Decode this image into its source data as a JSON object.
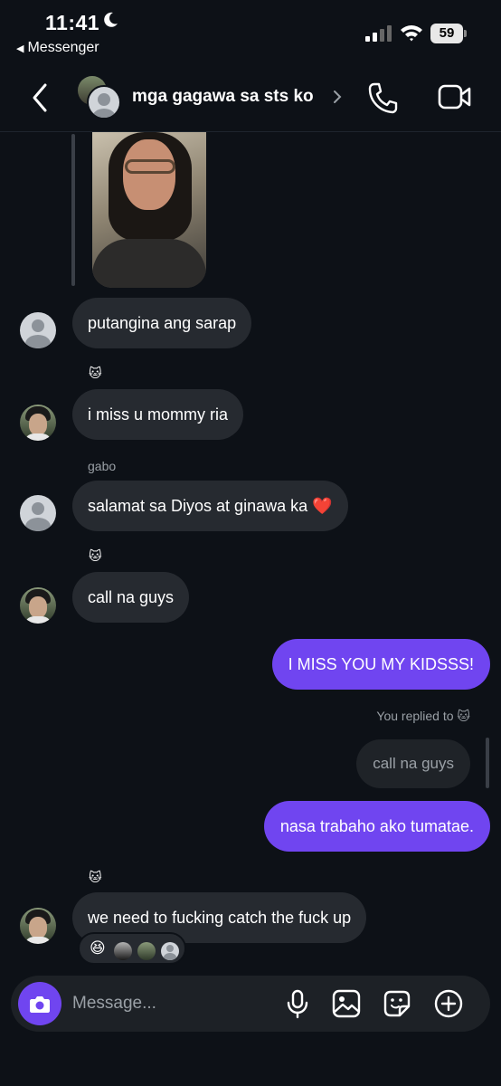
{
  "status_bar": {
    "time": "11:41",
    "back_app": "Messenger",
    "battery": "59"
  },
  "header": {
    "title": "mga gagawa sa sts ko"
  },
  "messages": [
    {
      "text": "putangina ang sarap"
    },
    {
      "sender": "🐱",
      "text": "i miss u mommy ria"
    },
    {
      "sender": "gabo",
      "text": "salamat sa Diyos at ginawa ka ❤️"
    },
    {
      "sender": "🐱",
      "text": "call na guys"
    },
    {
      "text": "I MISS YOU MY KIDSSS!"
    },
    {
      "text": "nasa trabaho ako tumatae."
    },
    {
      "sender": "🐱",
      "text": "we need to fucking catch the fuck up"
    }
  ],
  "reply": {
    "label": "You replied to 🐱",
    "quoted": "call na guys"
  },
  "reactions": {
    "emoji": "😆"
  },
  "composer": {
    "placeholder": "Message..."
  },
  "colors": {
    "background": "#0d1117",
    "incoming_bubble": "#262a30",
    "outgoing_bubble": "#7045f0",
    "accent": "#7045f0"
  },
  "icons": [
    "moon-icon",
    "signal-icon",
    "wifi-icon",
    "back-chevron-icon",
    "chevron-right-icon",
    "phone-icon",
    "video-camera-icon",
    "camera-icon",
    "microphone-icon",
    "image-icon",
    "sticker-icon",
    "plus-circle-icon"
  ]
}
